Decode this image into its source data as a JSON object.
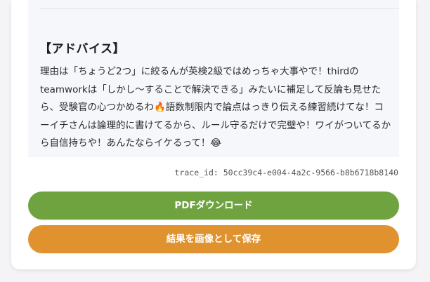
{
  "advice": {
    "title": "【アドバイス】",
    "body": "理由は「ちょうど2つ」に絞るんが英検2級ではめっちゃ大事やで！thirdのteamworkは「しかし〜することで解決できる」みたいに補足して反論も見せたら、受験官の心つかめるわ🔥語数制限内で論点はっきり伝える練習続けてな！コーイチさんは論理的に書けてるから、ルール守るだけで完璧や！ワイがついてるから自信持ちや！あんたならイケるって！😂"
  },
  "trace": {
    "text": "trace_id: 50cc39c4-e004-4a2c-9566-b8b6718b8140"
  },
  "actions": {
    "pdf_download_label": "PDFダウンロード",
    "save_image_label": "結果を画像として保存"
  },
  "colors": {
    "pdf_button": "#6fa33f",
    "save_image_button": "#e0922f",
    "panel_background": "#f6f7fb"
  }
}
